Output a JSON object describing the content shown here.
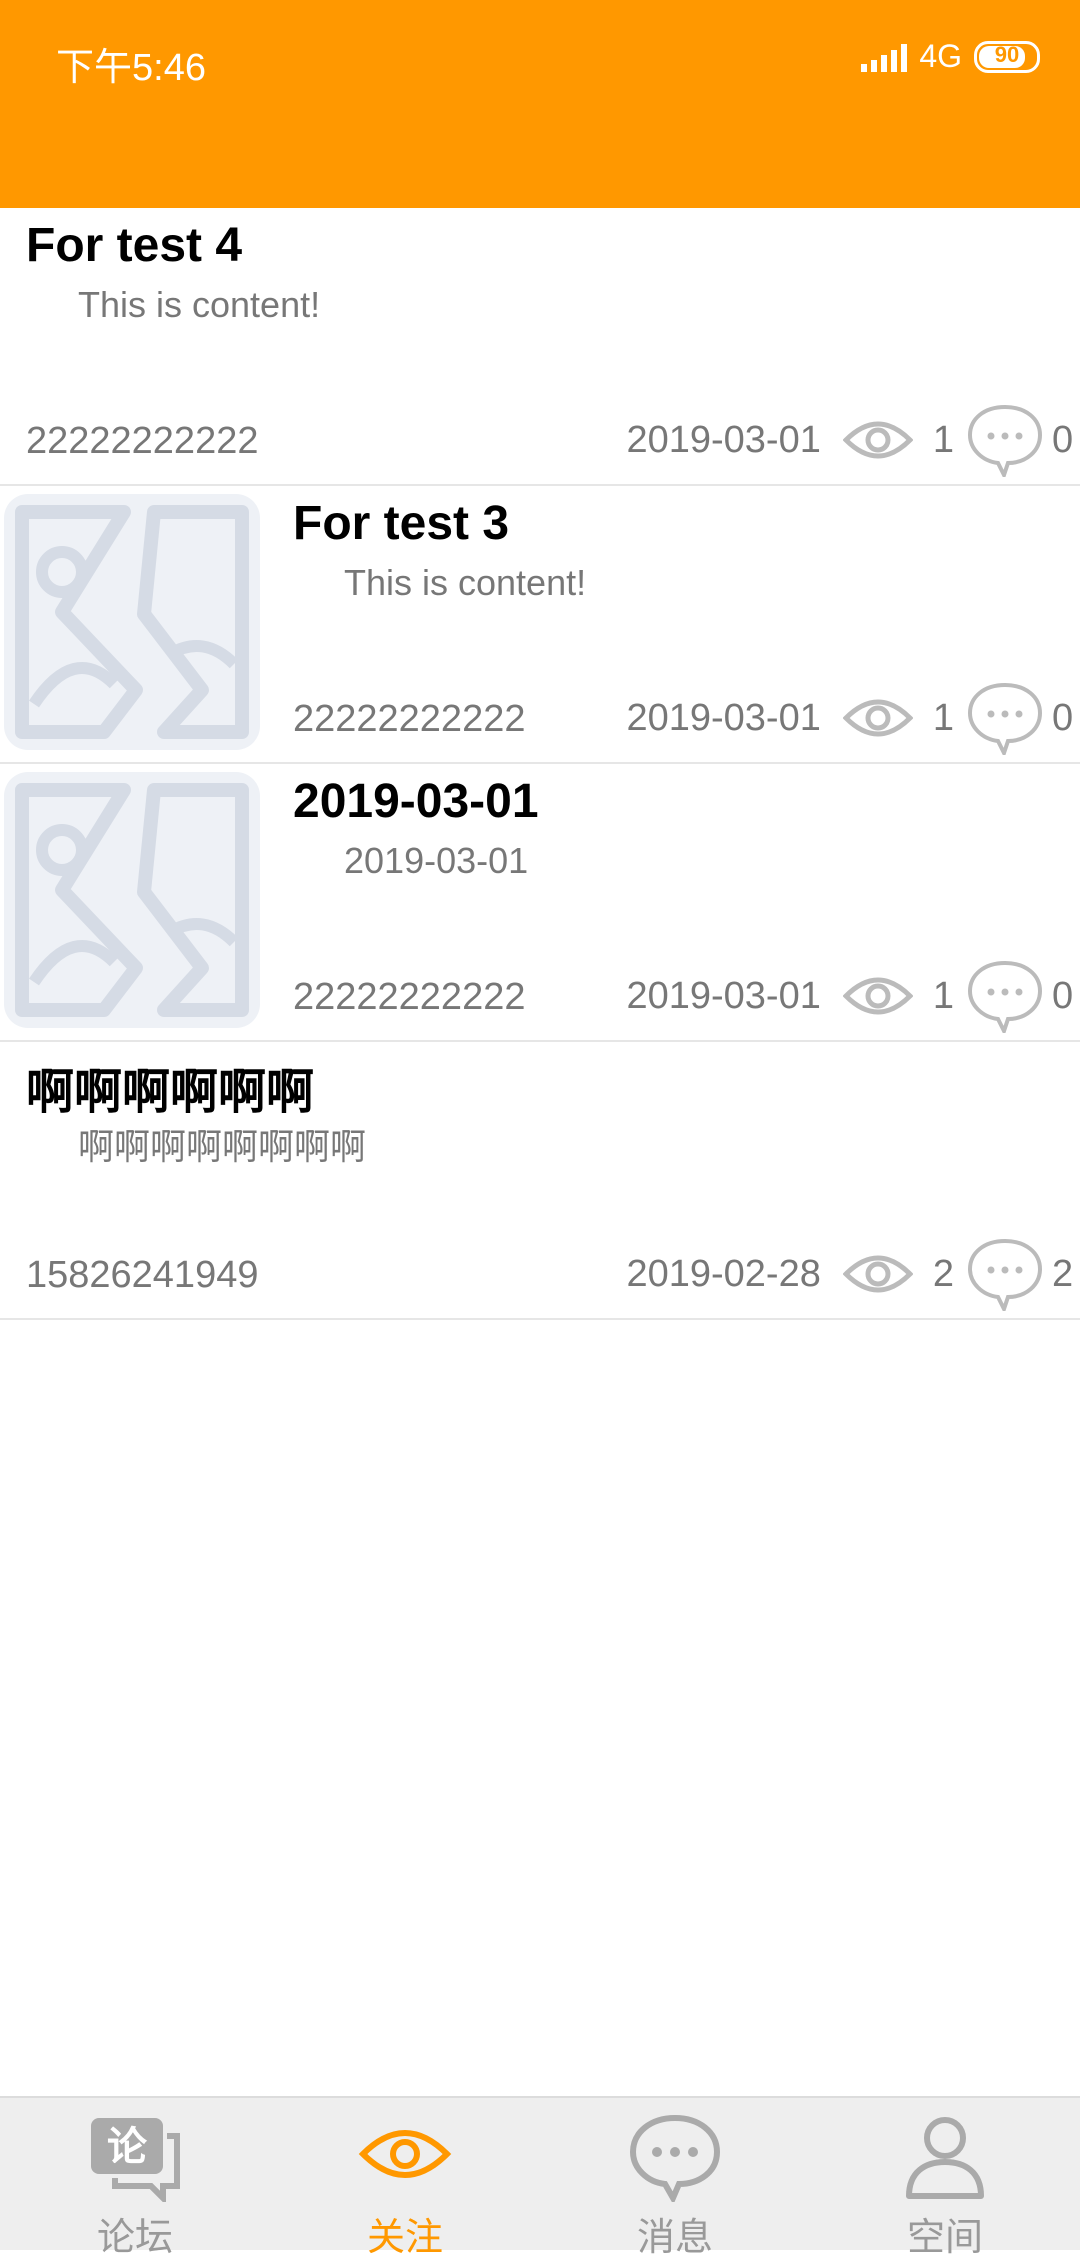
{
  "status": {
    "time": "下午5:46",
    "network": "4G",
    "battery": "90"
  },
  "posts": [
    {
      "title": "For test 4",
      "content": "This is content!",
      "author": "22222222222",
      "date": "2019-03-01",
      "views": "1",
      "comments": "0",
      "has_image": false
    },
    {
      "title": "For test 3",
      "content": "This is content!",
      "author": "22222222222",
      "date": "2019-03-01",
      "views": "1",
      "comments": "0",
      "has_image": true
    },
    {
      "title": "2019-03-01",
      "content": "2019-03-01",
      "author": "22222222222",
      "date": "2019-03-01",
      "views": "1",
      "comments": "0",
      "has_image": true
    },
    {
      "title": "啊啊啊啊啊啊",
      "content": "啊啊啊啊啊啊啊啊",
      "author": "15826241949",
      "date": "2019-02-28",
      "views": "2",
      "comments": "2",
      "has_image": false
    }
  ],
  "tabs": [
    {
      "label": "论坛",
      "icon": "forum-icon"
    },
    {
      "label": "关注",
      "icon": "eye-icon"
    },
    {
      "label": "消息",
      "icon": "message-icon"
    },
    {
      "label": "空间",
      "icon": "person-icon"
    }
  ],
  "colors": {
    "accent": "#FF9800",
    "tab_inactive": "#999999",
    "tab_bar": "#EEEEEE"
  }
}
